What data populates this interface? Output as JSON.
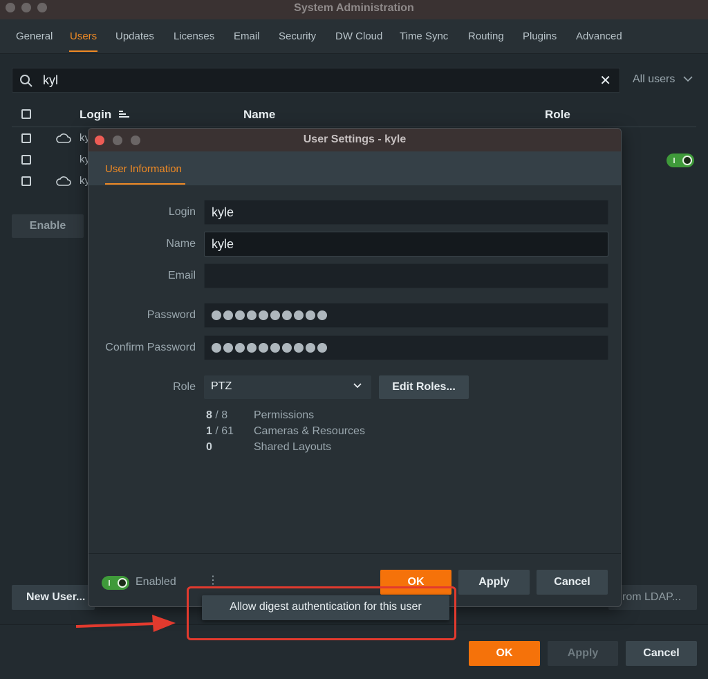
{
  "window": {
    "title": "System Administration"
  },
  "tabs": [
    {
      "label": "General"
    },
    {
      "label": "Users"
    },
    {
      "label": "Updates"
    },
    {
      "label": "Licenses"
    },
    {
      "label": "Email"
    },
    {
      "label": "Security"
    },
    {
      "label": "DW Cloud"
    },
    {
      "label": "Time Sync"
    },
    {
      "label": "Routing"
    },
    {
      "label": "Plugins"
    },
    {
      "label": "Advanced"
    }
  ],
  "active_tab": "Users",
  "search": {
    "value": "kyl",
    "filter": "All users"
  },
  "table": {
    "columns": {
      "login": "Login",
      "name": "Name",
      "role": "Role"
    },
    "rows": [
      {
        "login": "ky"
      },
      {
        "login": "ky"
      },
      {
        "login": "ky"
      }
    ]
  },
  "left_buttons": {
    "enable": "Enable",
    "new_user": "New User..."
  },
  "right_buttons": {
    "from_ldap": "rom LDAP..."
  },
  "bottom_bar": {
    "ok": "OK",
    "apply": "Apply",
    "cancel": "Cancel"
  },
  "dialog": {
    "title": "User Settings - kyle",
    "tab": "User Information",
    "fields": {
      "login_label": "Login",
      "login_value": "kyle",
      "name_label": "Name",
      "name_value": "kyle",
      "email_label": "Email",
      "email_value": "",
      "password_label": "Password",
      "confirm_label": "Confirm Password",
      "role_label": "Role",
      "role_value": "PTZ"
    },
    "edit_roles": "Edit Roles...",
    "stats": [
      {
        "value": "8",
        "total": "/ 8",
        "label": "Permissions"
      },
      {
        "value": "1",
        "total": "/ 61",
        "label": "Cameras & Resources"
      },
      {
        "value": "0",
        "total": "",
        "label": "Shared Layouts"
      }
    ],
    "enabled_label": "Enabled",
    "more_dots": "⋮",
    "ok": "OK",
    "apply": "Apply",
    "cancel": "Cancel"
  },
  "context_menu": {
    "item": "Allow digest authentication for this user"
  },
  "colors": {
    "accent": "#f08a24",
    "toggle": "#3f9a3a",
    "annotation": "#e23a2e"
  }
}
